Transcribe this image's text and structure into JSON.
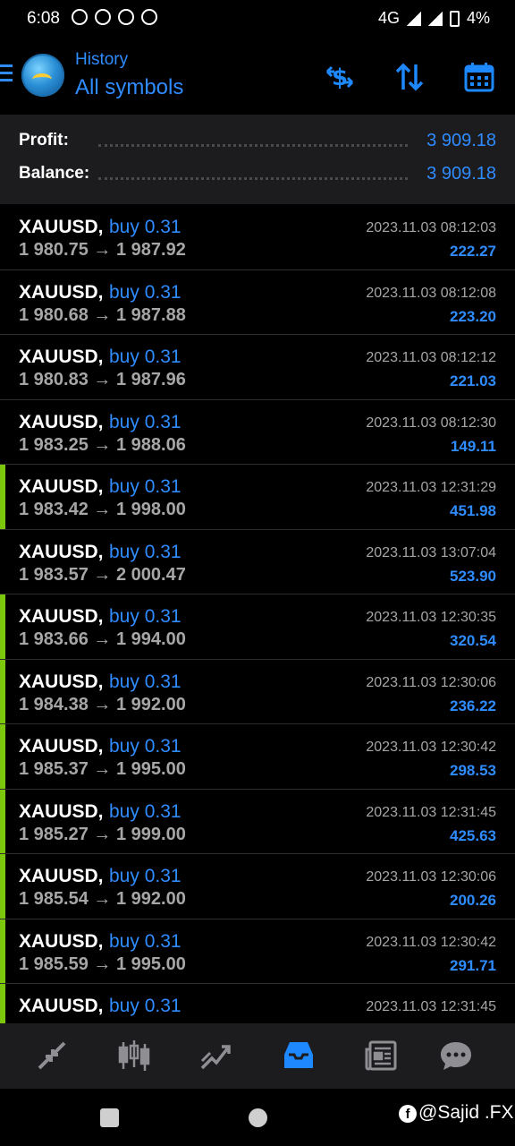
{
  "status_bar": {
    "time": "6:08",
    "network": "4G",
    "battery": "4%"
  },
  "header": {
    "subtitle": "History",
    "title": "All symbols"
  },
  "summary": {
    "profit_label": "Profit:",
    "profit_value": "3 909.18",
    "balance_label": "Balance:",
    "balance_value": "3 909.18"
  },
  "trades": [
    {
      "symbol": "XAUUSD,",
      "side": "buy 0.31",
      "prices": "1 980.75 → 1 987.92",
      "datetime": "2023.11.03 08:12:03",
      "profit": "222.27",
      "marked": false
    },
    {
      "symbol": "XAUUSD,",
      "side": "buy 0.31",
      "prices": "1 980.68 → 1 987.88",
      "datetime": "2023.11.03 08:12:08",
      "profit": "223.20",
      "marked": false
    },
    {
      "symbol": "XAUUSD,",
      "side": "buy 0.31",
      "prices": "1 980.83 → 1 987.96",
      "datetime": "2023.11.03 08:12:12",
      "profit": "221.03",
      "marked": false
    },
    {
      "symbol": "XAUUSD,",
      "side": "buy 0.31",
      "prices": "1 983.25 → 1 988.06",
      "datetime": "2023.11.03 08:12:30",
      "profit": "149.11",
      "marked": false
    },
    {
      "symbol": "XAUUSD,",
      "side": "buy 0.31",
      "prices": "1 983.42 → 1 998.00",
      "datetime": "2023.11.03 12:31:29",
      "profit": "451.98",
      "marked": true
    },
    {
      "symbol": "XAUUSD,",
      "side": "buy 0.31",
      "prices": "1 983.57 → 2 000.47",
      "datetime": "2023.11.03 13:07:04",
      "profit": "523.90",
      "marked": false
    },
    {
      "symbol": "XAUUSD,",
      "side": "buy 0.31",
      "prices": "1 983.66 → 1 994.00",
      "datetime": "2023.11.03 12:30:35",
      "profit": "320.54",
      "marked": true
    },
    {
      "symbol": "XAUUSD,",
      "side": "buy 0.31",
      "prices": "1 984.38 → 1 992.00",
      "datetime": "2023.11.03 12:30:06",
      "profit": "236.22",
      "marked": true
    },
    {
      "symbol": "XAUUSD,",
      "side": "buy 0.31",
      "prices": "1 985.37 → 1 995.00",
      "datetime": "2023.11.03 12:30:42",
      "profit": "298.53",
      "marked": true
    },
    {
      "symbol": "XAUUSD,",
      "side": "buy 0.31",
      "prices": "1 985.27 → 1 999.00",
      "datetime": "2023.11.03 12:31:45",
      "profit": "425.63",
      "marked": true
    },
    {
      "symbol": "XAUUSD,",
      "side": "buy 0.31",
      "prices": "1 985.54 → 1 992.00",
      "datetime": "2023.11.03 12:30:06",
      "profit": "200.26",
      "marked": true
    },
    {
      "symbol": "XAUUSD,",
      "side": "buy 0.31",
      "prices": "1 985.59 → 1 995.00",
      "datetime": "2023.11.03 12:30:42",
      "profit": "291.71",
      "marked": true
    },
    {
      "symbol": "XAUUSD,",
      "side": "buy 0.31",
      "prices": "",
      "datetime": "2023.11.03 12:31:45",
      "profit": "",
      "marked": true
    }
  ],
  "bottom_nav": [
    {
      "icon": "quotes-icon",
      "active": false
    },
    {
      "icon": "chart-icon",
      "active": false
    },
    {
      "icon": "trade-icon",
      "active": false
    },
    {
      "icon": "history-icon",
      "active": true
    },
    {
      "icon": "news-icon",
      "active": false
    },
    {
      "icon": "chat-icon",
      "active": false
    }
  ],
  "watermark": {
    "text": "@Sajid .FX"
  },
  "colors": {
    "accent": "#2f8cff",
    "marker": "#7ac70c",
    "panel": "#1c1c1e"
  }
}
